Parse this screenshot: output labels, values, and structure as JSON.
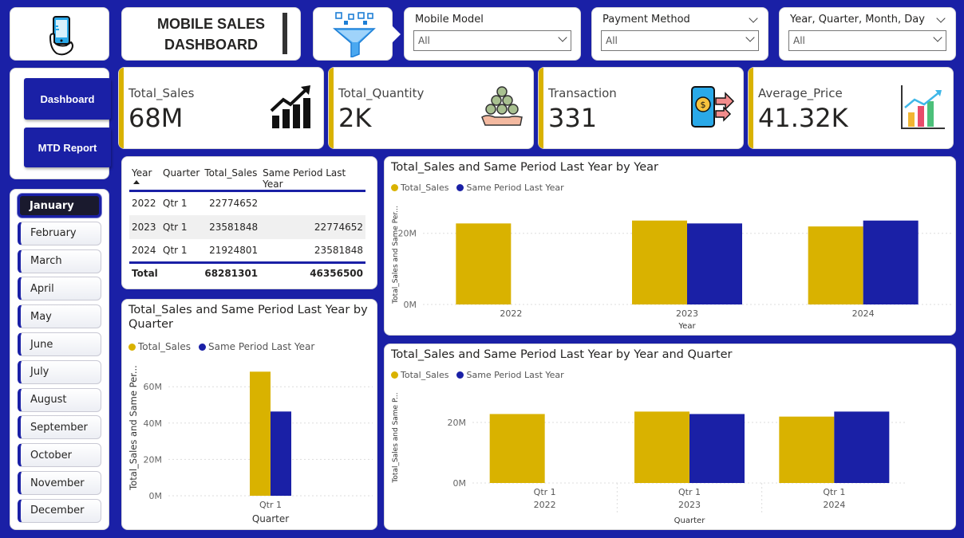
{
  "header": {
    "title": "MOBILE SALES\nDASHBOARD",
    "logo_icon": "phone-hand-icon",
    "filter_icon": "funnel-icon"
  },
  "slicers": {
    "mobile_model": {
      "label": "Mobile Model",
      "value": "All"
    },
    "payment_method": {
      "label": "Payment Method",
      "value": "All"
    },
    "date": {
      "label": "Year, Quarter, Month, Day",
      "value": "All"
    }
  },
  "nav": {
    "dashboard": "Dashboard",
    "mtd_report": "MTD Report"
  },
  "months": [
    "January",
    "February",
    "March",
    "April",
    "May",
    "June",
    "July",
    "August",
    "September",
    "October",
    "November",
    "December"
  ],
  "selected_month": "January",
  "kpis": [
    {
      "label": "Total_Sales",
      "value": "68M",
      "icon": "rising-bar-chart-icon"
    },
    {
      "label": "Total_Quantity",
      "value": "2K",
      "icon": "coins-hand-icon"
    },
    {
      "label": "Transaction",
      "value": "331",
      "icon": "mobile-payment-icon"
    },
    {
      "label": "Average_Price",
      "value": "41.32K",
      "icon": "analytics-chart-icon"
    }
  ],
  "table": {
    "headers": [
      "Year",
      "Quarter",
      "Total_Sales",
      "Same Period Last Year"
    ],
    "rows": [
      [
        "2022",
        "Qtr 1",
        "22774652",
        ""
      ],
      [
        "2023",
        "Qtr 1",
        "23581848",
        "22774652"
      ],
      [
        "2024",
        "Qtr 1",
        "21924801",
        "23581848"
      ]
    ],
    "total": [
      "Total",
      "",
      "68281301",
      "46356500"
    ]
  },
  "colors": {
    "total_sales": "#d9b200",
    "last_year": "#1a20a6",
    "background": "#1a20a6"
  },
  "chart_data": [
    {
      "type": "bar",
      "title": "Total_Sales and Same Period Last Year by Year",
      "xlabel": "Year",
      "ylabel": "Total_Sales and Same Per...",
      "categories": [
        "2022",
        "2023",
        "2024"
      ],
      "series": [
        {
          "name": "Total_Sales",
          "values": [
            22774652,
            23581848,
            21924801
          ]
        },
        {
          "name": "Same Period Last Year",
          "values": [
            null,
            22774652,
            23581848
          ]
        }
      ],
      "yticks": [
        "0M",
        "20M"
      ],
      "ylim": [
        0,
        28000000
      ],
      "legend": "top-left"
    },
    {
      "type": "bar",
      "title": "Total_Sales and Same Period Last Year by Quarter",
      "xlabel": "Quarter",
      "ylabel": "Total_Sales and Same Per...",
      "categories": [
        "Qtr 1"
      ],
      "series": [
        {
          "name": "Total_Sales",
          "values": [
            68281301
          ]
        },
        {
          "name": "Same Period Last Year",
          "values": [
            46356500
          ]
        }
      ],
      "yticks": [
        "0M",
        "20M",
        "40M",
        "60M"
      ],
      "ylim": [
        0,
        75000000
      ],
      "legend": "top-left"
    },
    {
      "type": "bar",
      "title": "Total_Sales and Same Period Last Year by Year and Quarter",
      "xlabel": "Quarter",
      "ylabel": "Total_Sales and Same P...",
      "categories": [
        "Qtr 1",
        "Qtr 1",
        "Qtr 1"
      ],
      "groups": [
        "2022",
        "2023",
        "2024"
      ],
      "series": [
        {
          "name": "Total_Sales",
          "values": [
            22774652,
            23581848,
            21924801
          ]
        },
        {
          "name": "Same Period Last Year",
          "values": [
            null,
            22774652,
            23581848
          ]
        }
      ],
      "yticks": [
        "0M",
        "20M"
      ],
      "ylim": [
        0,
        30000000
      ],
      "legend": "top-left"
    }
  ]
}
